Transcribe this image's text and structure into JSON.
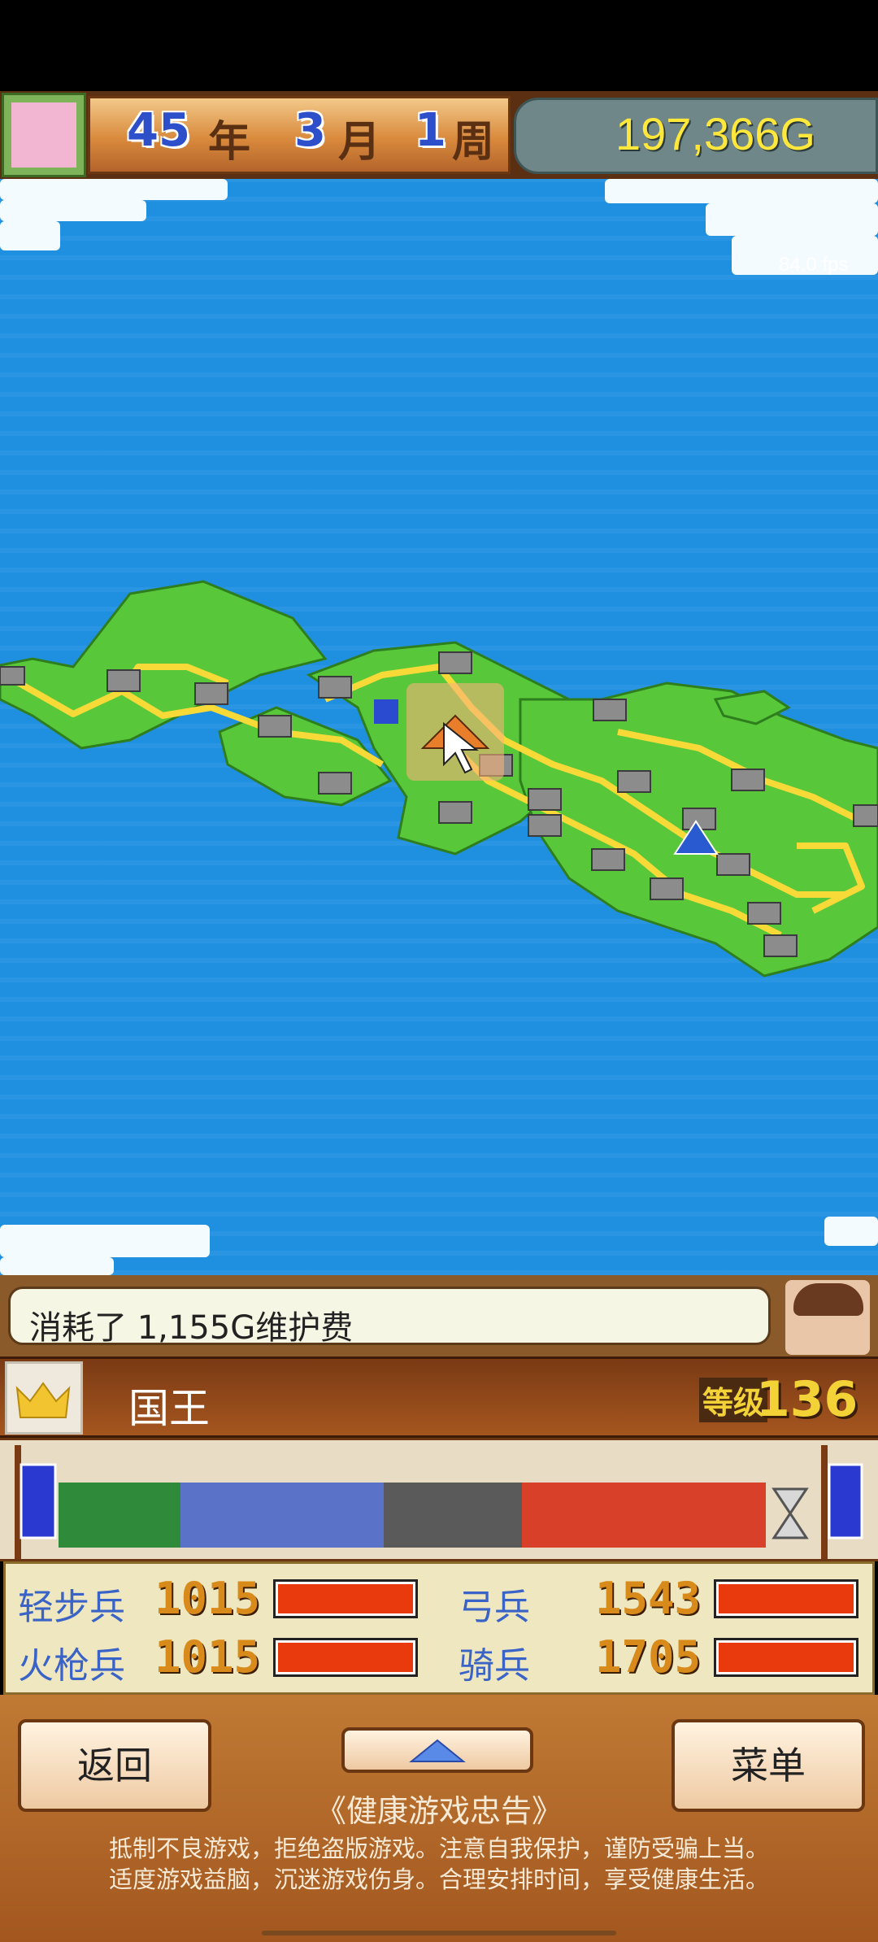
{
  "header": {
    "year_value": "45",
    "year_unit": "年",
    "month_value": "3",
    "month_unit": "月",
    "week_value": "1",
    "week_unit": "周",
    "gold": "197,366G"
  },
  "map": {
    "fps_text": "84.0 fps"
  },
  "message": {
    "text": "消耗了 1,155G维护费"
  },
  "ruler": {
    "title": "国王",
    "level_label": "等级",
    "level_value": "136"
  },
  "troops": [
    {
      "label": "轻步兵",
      "value": "1015",
      "fill": 1.0
    },
    {
      "label": "弓兵",
      "value": "1543",
      "fill": 1.0
    },
    {
      "label": "火枪兵",
      "value": "1015",
      "fill": 1.0
    },
    {
      "label": "骑兵",
      "value": "1705",
      "fill": 1.0
    }
  ],
  "buttons": {
    "back_label": "返回",
    "menu_label": "菜单"
  },
  "health_notice": {
    "title": "《健康游戏忠告》",
    "line1": "抵制不良游戏，拒绝盗版游戏。注意自我保护，谨防受骗上当。",
    "line2": "适度游戏益脑，沉迷游戏伤身。合理安排时间，享受健康生活。"
  },
  "colors": {
    "sea": "#1f8fe0",
    "land": "#58c83a",
    "road": "#f7d938",
    "gold_text": "#ffe83b",
    "troop_bar": "#e83a0c"
  }
}
